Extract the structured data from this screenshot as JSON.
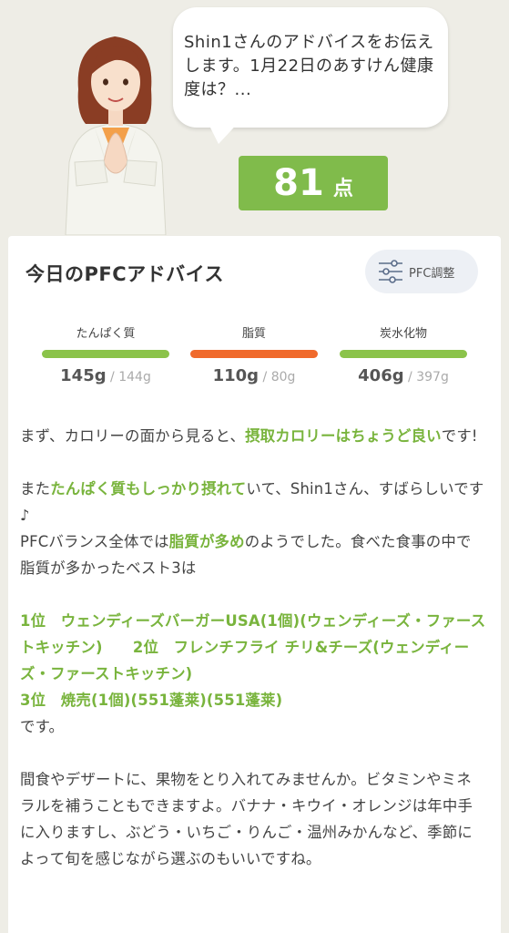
{
  "bubble": {
    "text": "Shin1さんのアドバイスをお伝えします。1月22日のあすけん健康度は？..."
  },
  "score": {
    "value": "81",
    "unit": "点"
  },
  "card": {
    "title": "今日のPFCアドバイス",
    "pfc_button_label": "PFC調整",
    "pfc_button_icon": "sliders-icon"
  },
  "nutrients": [
    {
      "label": "たんぱく質",
      "value": "145g",
      "sep": " / ",
      "target": "144g",
      "color": "#8bc34a"
    },
    {
      "label": "脂質",
      "value": "110g",
      "sep": " / ",
      "target": "80g",
      "color": "#f06a2c"
    },
    {
      "label": "炭水化物",
      "value": "406g",
      "sep": " / ",
      "target": "397g",
      "color": "#8bc34a"
    }
  ],
  "advice": {
    "p1_a": "まず、カロリーの面から見ると、",
    "p1_hl": "摂取カロリーはちょうど良い",
    "p1_b": "です!",
    "p2_a": "また",
    "p2_hl": "たんぱく質もしっかり摂れて",
    "p2_b": "いて、Shin1さん、すばらしいです♪",
    "p3_a": "PFCバランス全体では",
    "p3_hl": "脂質が多め",
    "p3_b": "のようでした。食べた食事の中で脂質が多かったベスト3は",
    "ranks": [
      "1位　ウェンディーズバーガーUSA(1個)(ウェンディーズ・ファーストキッチン)",
      "2位　フレンチフライ チリ&チーズ(ウェンディーズ・ファーストキッチン)",
      "3位　焼売(1個)(551蓬莱)(551蓬莱)"
    ],
    "p4": "です。",
    "p5": "間食やデザートに、果物をとり入れてみませんか。ビタミンやミネラルを補うこともできますよ。バナナ・キウイ・オレンジは年中手に入りますし、ぶどう・いちご・りんご・温州みかんなど、季節によって旬を感じながら選ぶのもいいですね。"
  },
  "colors": {
    "accent_green": "#80bb4b",
    "fat_orange": "#f06a2c",
    "background": "#eeede6"
  }
}
